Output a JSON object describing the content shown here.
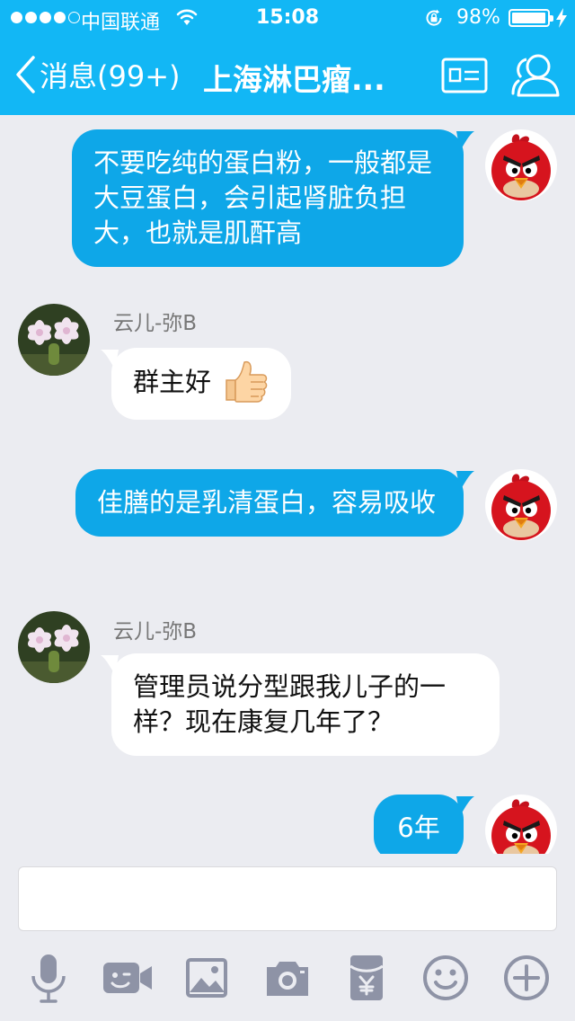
{
  "status_bar": {
    "carrier": "中国联通",
    "time": "15:08",
    "battery_percent": "98%",
    "battery_level": 0.98
  },
  "nav": {
    "back_label": "消息(99+)",
    "title": "上海淋巴瘤...",
    "accent_color": "#12b7f5"
  },
  "messages": [
    {
      "side": "out",
      "text": "不要吃纯的蛋白粉，一般都是大豆蛋白，会引起肾脏负担大，也就是肌酐高",
      "avatar": "angry-bird-avatar"
    },
    {
      "side": "in",
      "sender": "云儿-弥B",
      "text": "群主好",
      "emoji": "thumbs-up-emoji",
      "avatar": "cactus-flower-avatar"
    },
    {
      "side": "out",
      "text": "佳膳的是乳清蛋白，容易吸收",
      "avatar": "angry-bird-avatar"
    },
    {
      "side": "in",
      "sender": "云儿-弥B",
      "text": "管理员说分型跟我儿子的一样？现在康复几年了？",
      "avatar": "cactus-flower-avatar"
    },
    {
      "side": "out",
      "text": "6年",
      "avatar": "angry-bird-avatar"
    }
  ],
  "input": {
    "value": "",
    "placeholder": ""
  },
  "toolbar": [
    "microphone-icon",
    "video-call-icon",
    "image-icon",
    "camera-icon",
    "red-packet-icon",
    "emoji-icon",
    "plus-icon"
  ],
  "colors": {
    "outgoing_bubble": "#0ea7e8",
    "incoming_bubble": "#ffffff",
    "background": "#ebecf1",
    "icon_gray": "#8e93a6"
  }
}
